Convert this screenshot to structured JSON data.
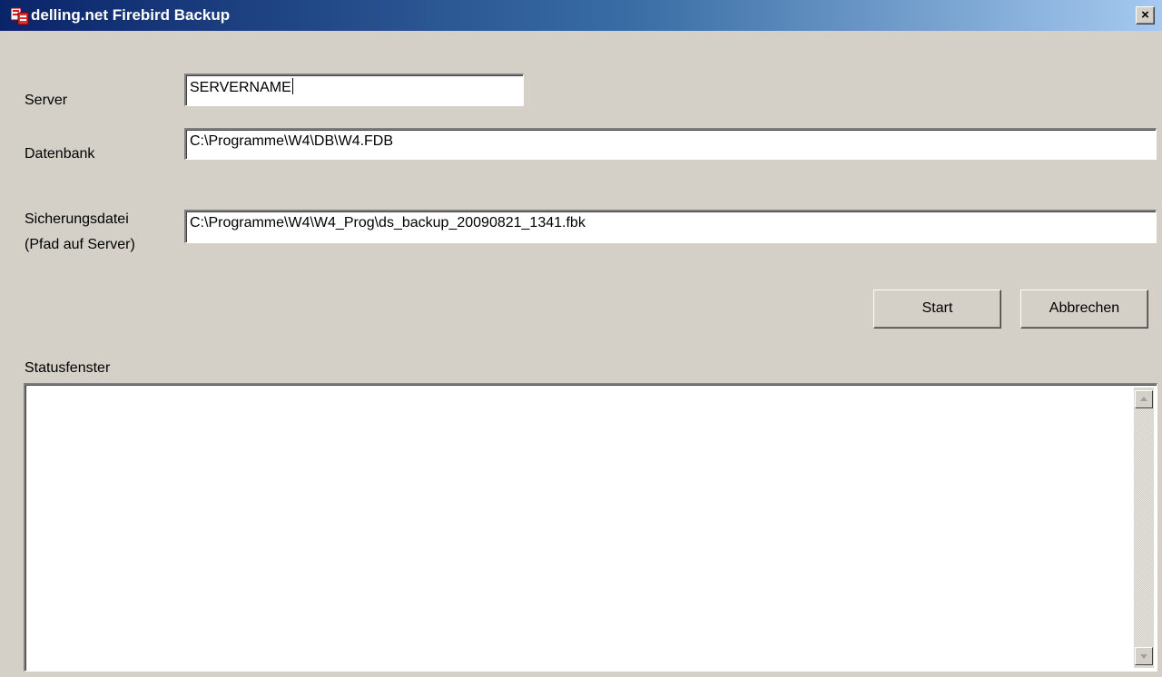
{
  "window": {
    "title": "delling.net Firebird Backup",
    "close_label": "×",
    "icon": "firebird-backup-app-icon"
  },
  "form": {
    "server_label": "Server",
    "server_value": "SERVERNAME",
    "database_label": "Datenbank",
    "database_value": "C:\\Programme\\W4\\DB\\W4.FDB",
    "backup_label_line1": "Sicherungsdatei",
    "backup_label_line2": "(Pfad auf Server)",
    "backup_value": "C:\\Programme\\W4\\W4_Prog\\ds_backup_20090821_1341.fbk"
  },
  "buttons": {
    "start_label": "Start",
    "cancel_label": "Abbrechen"
  },
  "status": {
    "label": "Statusfenster",
    "content": ""
  },
  "colors": {
    "titlebar_start": "#0a246a",
    "titlebar_end": "#a6caf0",
    "dialog_bg": "#d4d0c8"
  },
  "icons": {
    "close": "close-icon",
    "scroll_up": "scroll-up-arrow-icon",
    "scroll_down": "scroll-down-arrow-icon"
  }
}
